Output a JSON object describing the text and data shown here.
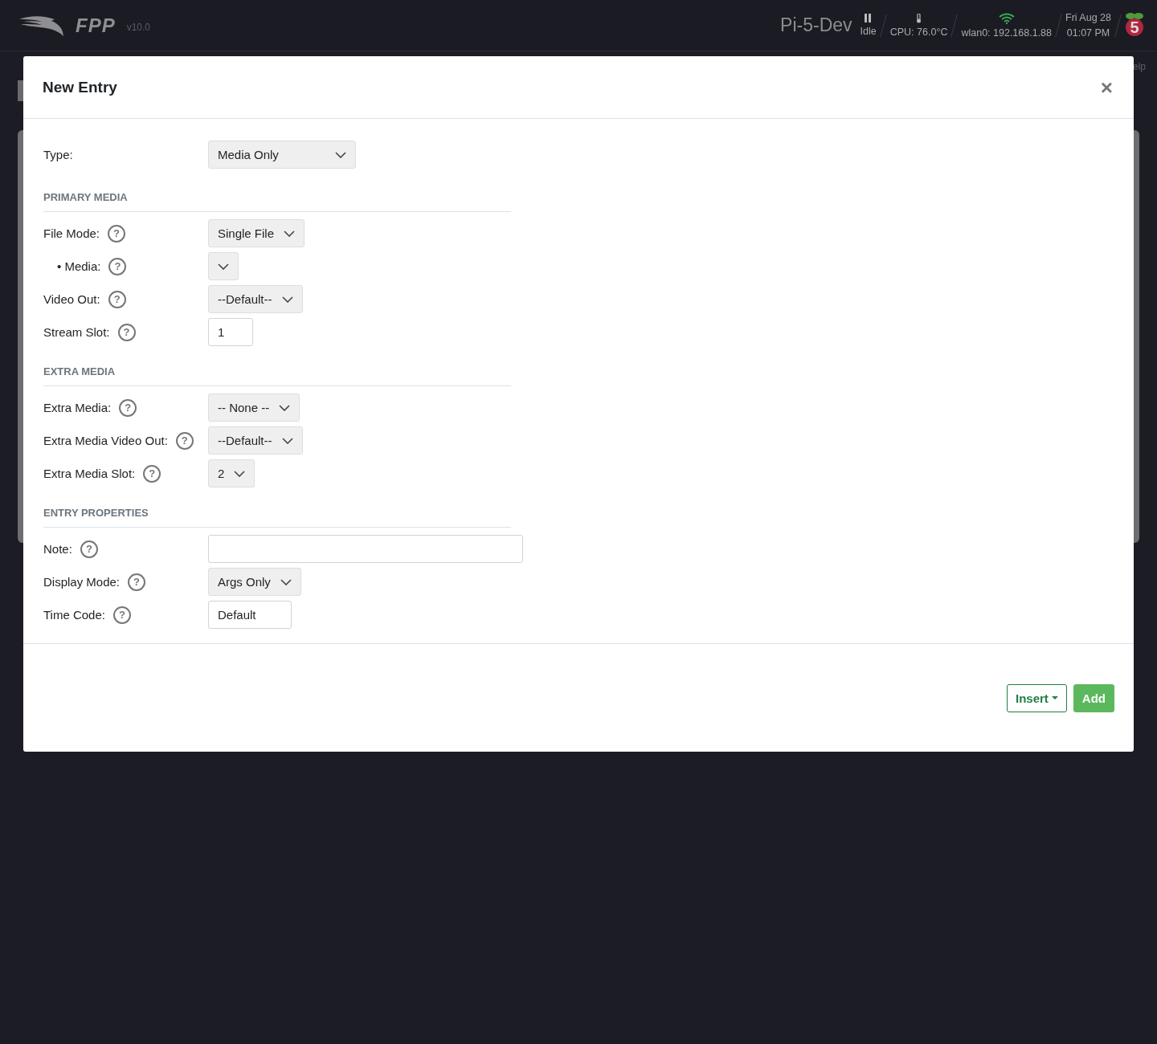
{
  "header": {
    "logo": "FPP",
    "version": "v10.0",
    "host": "Pi-5-Dev",
    "status": "Idle",
    "cpu": "CPU: 76.0°C",
    "network": "wlan0: 192.168.1.88",
    "date": "Fri Aug 28",
    "time": "01:07 PM",
    "board_badge": "5"
  },
  "background_page": {
    "help_link": "elp"
  },
  "modal": {
    "title": "New Entry",
    "close": "×",
    "type_row": {
      "label": "Type:",
      "kind": "select",
      "value": "Media Only"
    },
    "sections": [
      {
        "title": "PRIMARY MEDIA",
        "rows": [
          {
            "label": "File Mode:",
            "indented": false,
            "help": "?",
            "kind": "select",
            "value": "Single File"
          },
          {
            "label": "• Media:",
            "indented": true,
            "help": "?",
            "kind": "select",
            "value": ""
          },
          {
            "label": "Video Out:",
            "indented": false,
            "help": "?",
            "kind": "select",
            "value": "--Default--"
          },
          {
            "label": "Stream Slot:",
            "indented": false,
            "help": "?",
            "kind": "number",
            "value": "1"
          }
        ]
      },
      {
        "title": "EXTRA MEDIA",
        "rows": [
          {
            "label": "Extra Media:",
            "indented": false,
            "help": "?",
            "kind": "select",
            "value": "-- None --"
          },
          {
            "label": "Extra Media Video Out:",
            "indented": false,
            "help": "?",
            "kind": "select",
            "value": "--Default--"
          },
          {
            "label": "Extra Media Slot:",
            "indented": false,
            "help": "?",
            "kind": "select",
            "value": "2"
          }
        ]
      },
      {
        "title": "ENTRY PROPERTIES",
        "rows": [
          {
            "label": "Note:",
            "indented": false,
            "help": "?",
            "kind": "text",
            "value": ""
          },
          {
            "label": "Display Mode:",
            "indented": false,
            "help": "?",
            "kind": "select",
            "value": "Args Only"
          },
          {
            "label": "Time Code:",
            "indented": false,
            "help": "?",
            "kind": "input",
            "value": "Default"
          }
        ]
      }
    ],
    "buttons": [
      {
        "label": "Insert",
        "kind": "dropdown"
      },
      {
        "label": "Add",
        "kind": "primary"
      }
    ]
  }
}
